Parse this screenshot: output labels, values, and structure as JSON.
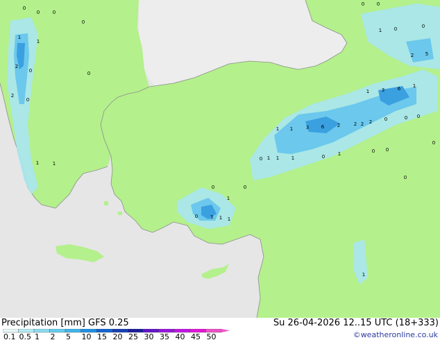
{
  "map": {
    "colors": {
      "sea": "#e6e6e6",
      "land_precip_area": "#b4f08c",
      "land_dry": "#ededed",
      "precip_light": "#a8e6f0",
      "precip_medium": "#6cc8ec",
      "precip_heavy": "#3aa0e0",
      "coast": "#8c8c8c"
    },
    "value_labels": [
      "0",
      "0",
      "0",
      "0",
      "1",
      "1",
      "0",
      "0",
      "1",
      "0",
      "0",
      "2",
      "5",
      "2",
      "0",
      "1",
      "2",
      "0",
      "1",
      "3",
      "6",
      "1",
      "0",
      "0",
      "1",
      "2",
      "3",
      "6",
      "2",
      "2",
      "2",
      "0",
      "0",
      "1",
      "1",
      "0",
      "0",
      "1",
      "1",
      "0",
      "1",
      "0",
      "0",
      "0",
      "1",
      "0",
      "0",
      "1",
      "1",
      "0",
      "3",
      "1",
      "1"
    ]
  },
  "footer": {
    "title": "Precipitation [mm] GFS 0.25",
    "datetime": "Su 26-04-2026 12..15 UTC (18+333)",
    "credit": "©weatheronline.co.uk",
    "scale": [
      {
        "label": "0.1",
        "color": "#e8f8f8"
      },
      {
        "label": "0.5",
        "color": "#b4ecf4"
      },
      {
        "label": "1",
        "color": "#8cdcf0"
      },
      {
        "label": "2",
        "color": "#64cdf0"
      },
      {
        "label": "5",
        "color": "#40b4ec"
      },
      {
        "label": "10",
        "color": "#2090e4"
      },
      {
        "label": "15",
        "color": "#1464d0"
      },
      {
        "label": "20",
        "color": "#1440b4"
      },
      {
        "label": "25",
        "color": "#1c1c9c"
      },
      {
        "label": "30",
        "color": "#6414c8"
      },
      {
        "label": "35",
        "color": "#9614dc"
      },
      {
        "label": "40",
        "color": "#c414e4"
      },
      {
        "label": "45",
        "color": "#e414d8"
      },
      {
        "label": "50",
        "color": "#f050c8"
      }
    ]
  }
}
